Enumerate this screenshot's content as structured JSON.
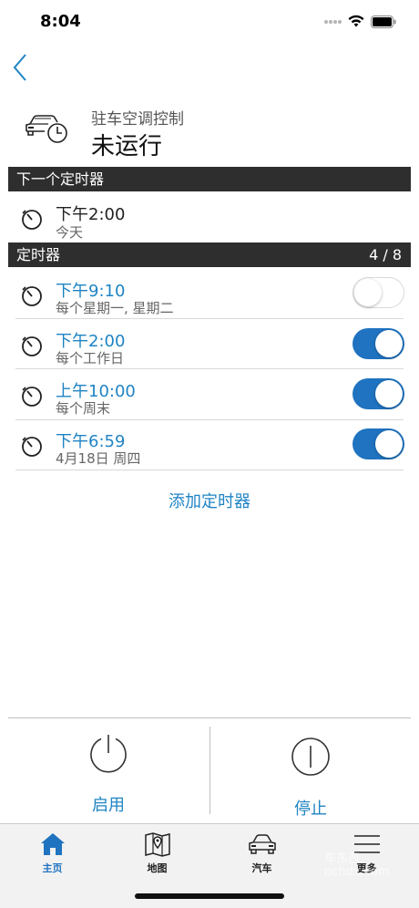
{
  "status_bar": {
    "time": "8:04"
  },
  "header": {
    "subtitle": "驻车空调控制",
    "title": "未运行"
  },
  "next_timer": {
    "section_label": "下一个定时器",
    "time": "下午2:00",
    "day": "今天"
  },
  "timers": {
    "section_label": "定时器",
    "count": "4 / 8",
    "items": [
      {
        "time": "下午9:10",
        "schedule": "每个星期一, 星期二",
        "enabled": false
      },
      {
        "time": "下午2:00",
        "schedule": "每个工作日",
        "enabled": true
      },
      {
        "time": "上午10:00",
        "schedule": "每个周末",
        "enabled": true
      },
      {
        "time": "下午6:59",
        "schedule": "4月18日 周四",
        "enabled": true
      }
    ]
  },
  "add_timer_label": "添加定时器",
  "controls": {
    "start_label": "启用",
    "stop_label": "停止"
  },
  "tab_bar": {
    "tabs": [
      {
        "label": "主页",
        "icon": "home-icon",
        "active": true
      },
      {
        "label": "地图",
        "icon": "map-icon",
        "active": false
      },
      {
        "label": "汽车",
        "icon": "car-icon",
        "active": false
      },
      {
        "label": "更多",
        "icon": "menu-icon",
        "active": false
      }
    ]
  },
  "watermark": "车东西 nchdx.com",
  "colors": {
    "accent": "#1f84c4",
    "toggle_on": "#1f73c0",
    "section_bar": "#2e2e2e"
  }
}
